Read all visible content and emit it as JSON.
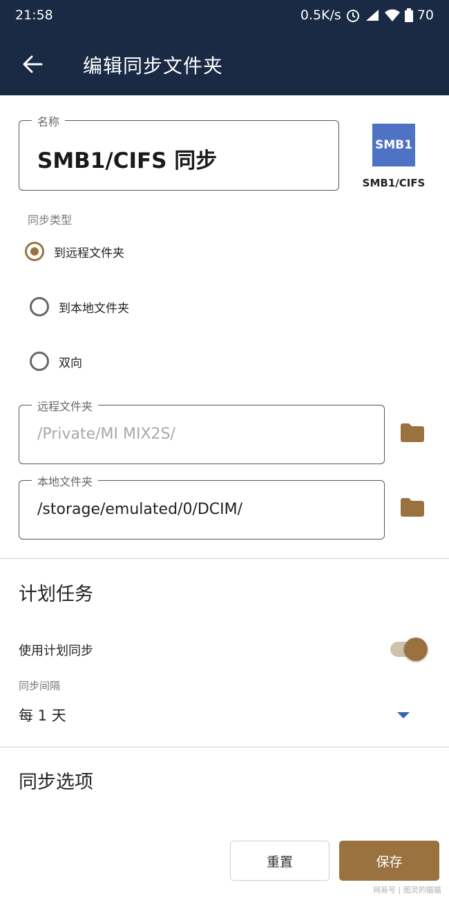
{
  "status_bar": {
    "time": "21:58",
    "network_speed": "0.5K/s",
    "battery": "70"
  },
  "app_bar": {
    "back_icon": "arrow-left-icon",
    "title": "编辑同步文件夹"
  },
  "name_field": {
    "label": "名称",
    "value": "SMB1/CIFS 同步"
  },
  "protocol": {
    "logo_text": "SMB1",
    "label": "SMB1/CIFS",
    "color": "#4f73c4"
  },
  "sync_type": {
    "label": "同步类型",
    "options": [
      {
        "label": "到远程文件夹",
        "selected": true
      },
      {
        "label": "到本地文件夹",
        "selected": false
      },
      {
        "label": "双向",
        "selected": false
      }
    ]
  },
  "remote_folder": {
    "label": "远程文件夹",
    "value": "/Private/MI MIX2S/",
    "icon": "folder-icon"
  },
  "local_folder": {
    "label": "本地文件夹",
    "value": "/storage/emulated/0/DCIM/",
    "icon": "folder-icon"
  },
  "schedule": {
    "title": "计划任务",
    "use_schedule_label": "使用计划同步",
    "use_schedule_on": true,
    "interval_label": "同步间隔",
    "interval_value": "每 1 天"
  },
  "sync_options": {
    "title": "同步选项"
  },
  "buttons": {
    "reset": "重置",
    "save": "保存"
  },
  "watermark": "网易号 | 图灵的猫猫",
  "colors": {
    "header_bg": "#1a2a44",
    "accent": "#9a7240",
    "dropdown_caret": "#3366b0"
  }
}
